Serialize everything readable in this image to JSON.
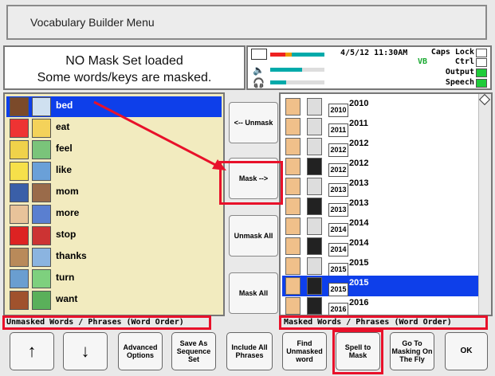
{
  "window": {
    "title": "Vocabulary Builder Menu"
  },
  "status": {
    "line1": "NO Mask Set loaded",
    "line2": "Some words/keys are masked."
  },
  "meters": {
    "clock": "4/5/12 11:30AM",
    "caps_lock_label": "Caps Lock",
    "vb_label": "VB",
    "ctrl_label": "Ctrl",
    "output_label": "Output",
    "speech_label": "Speech",
    "caps_lock_on": false,
    "ctrl_on": false,
    "output_on": true,
    "speech_on": true
  },
  "left_list": {
    "caption": "Unmasked Words / Phrases (Word Order)",
    "items": [
      {
        "label": "bed",
        "selected": true
      },
      {
        "label": "eat"
      },
      {
        "label": "feel"
      },
      {
        "label": "like"
      },
      {
        "label": "mom"
      },
      {
        "label": "more"
      },
      {
        "label": "stop"
      },
      {
        "label": "thanks"
      },
      {
        "label": "turn"
      },
      {
        "label": "want"
      }
    ]
  },
  "middle_buttons": {
    "unmask": "<-- Unmask",
    "mask": "Mask -->",
    "unmask_all": "Unmask All",
    "mask_all": "Mask All"
  },
  "right_list": {
    "caption": "Masked Words / Phrases (Word Order)",
    "items": [
      {
        "year": "2010",
        "label": "2010"
      },
      {
        "year": "2011",
        "label": "2011"
      },
      {
        "year": "2012",
        "label": "2012"
      },
      {
        "year": "2012",
        "label": "2012",
        "hold": true
      },
      {
        "year": "2013",
        "label": "2013"
      },
      {
        "year": "2013",
        "label": "2013",
        "hold": true
      },
      {
        "year": "2014",
        "label": "2014"
      },
      {
        "year": "2014",
        "label": "2014",
        "hold": true
      },
      {
        "year": "2015",
        "label": "2015"
      },
      {
        "year": "2015",
        "label": "2015",
        "hold": true,
        "selected": true
      },
      {
        "year": "2016",
        "label": "2016",
        "hold": true
      }
    ]
  },
  "bottom_buttons": {
    "up": "↑",
    "down": "↓",
    "advanced_options": "Advanced Options",
    "save_as_sequence_set": "Save As Sequence Set",
    "include_all_phrases": "Include All Phrases",
    "find_unmasked_word": "Find Unmasked word",
    "spell_to_mask": "Spell to Mask",
    "go_to_masking": "Go To Masking On The Fly",
    "ok": "OK"
  },
  "colors": {
    "highlight": "#e8112a",
    "selection": "#0e3fea",
    "left_bg": "#f2ebbf"
  }
}
